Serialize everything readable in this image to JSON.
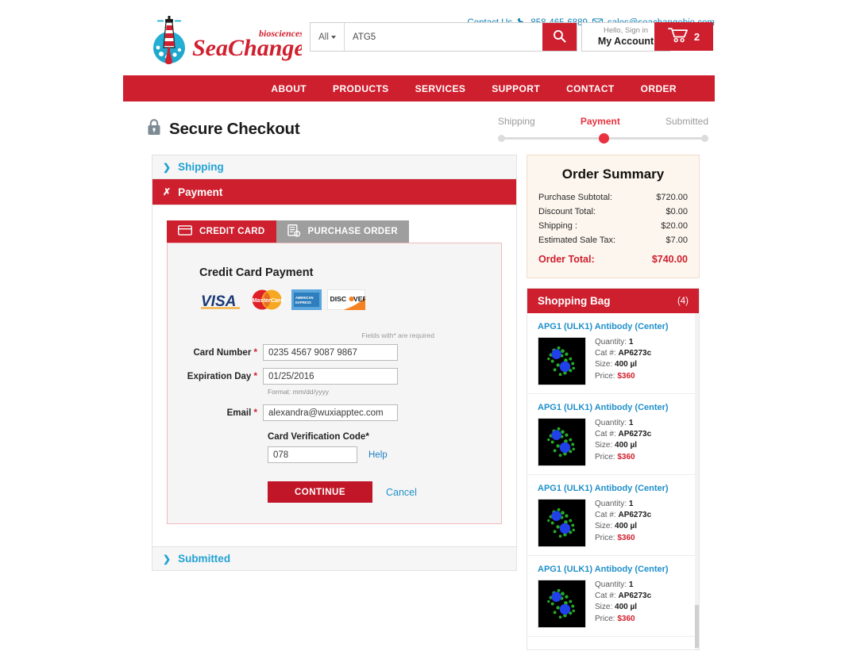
{
  "brand": {
    "name": "SeaChange",
    "tagline": "biosciences",
    "red": "#ce1f2e",
    "blue": "#1f8fcb"
  },
  "utility": {
    "contact_label": "Contact Us",
    "phone": "858-465-6889",
    "email": "sales@seachangebio.com",
    "phone_icon": "phone-icon",
    "email_icon": "envelope-icon"
  },
  "search": {
    "category": "All",
    "value": "ATG5",
    "placeholder": "",
    "search_icon": "magnifier-icon"
  },
  "account": {
    "hello": "Hello, Sign in",
    "label": "My Account"
  },
  "cart": {
    "count": "2",
    "icon": "shopping-cart-icon"
  },
  "nav": {
    "items": [
      {
        "label": "ABOUT"
      },
      {
        "label": "PRODUCTS"
      },
      {
        "label": "SERVICES"
      },
      {
        "label": "SUPPORT"
      },
      {
        "label": "CONTACT"
      },
      {
        "label": "ORDER"
      }
    ]
  },
  "checkout": {
    "title": "Secure Checkout",
    "lock_icon": "lock-icon",
    "steps": [
      {
        "label": "Shipping",
        "state": "inactive"
      },
      {
        "label": "Payment",
        "state": "active"
      },
      {
        "label": "Submitted",
        "state": "inactive"
      }
    ]
  },
  "sections": {
    "shipping": {
      "label": "Shipping",
      "chevron": "chevron-right-icon",
      "state": "collapsed"
    },
    "payment": {
      "label": "Payment",
      "chevron": "chevron-down-icon",
      "state": "expanded"
    },
    "submitted": {
      "label": "Submitted",
      "chevron": "chevron-right-icon",
      "state": "collapsed"
    }
  },
  "payment": {
    "tabs": [
      {
        "label": "CREDIT CARD",
        "icon": "credit-card-icon",
        "active": true
      },
      {
        "label": "PURCHASE ORDER",
        "icon": "purchase-order-icon",
        "active": false
      }
    ],
    "form_title": "Credit Card Payment",
    "accepted_cards": [
      "VISA",
      "MasterCard",
      "American Express",
      "DISCOVER"
    ],
    "required_note": "Fields with* are required",
    "fields": {
      "card_number": {
        "label": "Card Number",
        "required": "*",
        "value": "0235 4567 9087 9867"
      },
      "expiration": {
        "label": "Expiration Day",
        "required": "*",
        "value": "01/25/2016",
        "format_hint": "Format: mm/dd/yyyy"
      },
      "email": {
        "label": "Email",
        "required": "*",
        "value": "alexandra@wuxiapptec.com"
      },
      "cvc": {
        "label": "Card Verification Code*",
        "value": "078",
        "help_label": "Help"
      }
    },
    "continue_label": "CONTINUE",
    "cancel_label": "Cancel"
  },
  "order_summary": {
    "title": "Order Summary",
    "rows": [
      {
        "label": "Purchase Subtotal:",
        "value": "$720.00"
      },
      {
        "label": "Discount Total:",
        "value": "$0.00"
      },
      {
        "label": "Shipping :",
        "value": "$20.00"
      },
      {
        "label": "Estimated Sale Tax:",
        "value": "$7.00"
      }
    ],
    "total_label": "Order Total:",
    "total_value": "$740.00"
  },
  "shopping_bag": {
    "title": "Shopping Bag",
    "count": "(4)",
    "labels": {
      "quantity": "Quantity:",
      "cat": "Cat #:",
      "size": "Size:",
      "price": "Price:"
    },
    "items": [
      {
        "name": "APG1 (ULK1) Antibody (Center)",
        "quantity": "1",
        "cat": "AP6273c",
        "size": "400 µl",
        "price": "$360",
        "thumb": "immunofluorescence-cell-image"
      },
      {
        "name": "APG1 (ULK1) Antibody (Center)",
        "quantity": "1",
        "cat": "AP6273c",
        "size": "400 µl",
        "price": "$360",
        "thumb": "immunofluorescence-cell-image"
      },
      {
        "name": "APG1 (ULK1) Antibody (Center)",
        "quantity": "1",
        "cat": "AP6273c",
        "size": "400 µl",
        "price": "$360",
        "thumb": "immunofluorescence-cell-image"
      },
      {
        "name": "APG1 (ULK1) Antibody (Center)",
        "quantity": "1",
        "cat": "AP6273c",
        "size": "400 µl",
        "price": "$360",
        "thumb": "immunofluorescence-cell-image"
      }
    ]
  }
}
